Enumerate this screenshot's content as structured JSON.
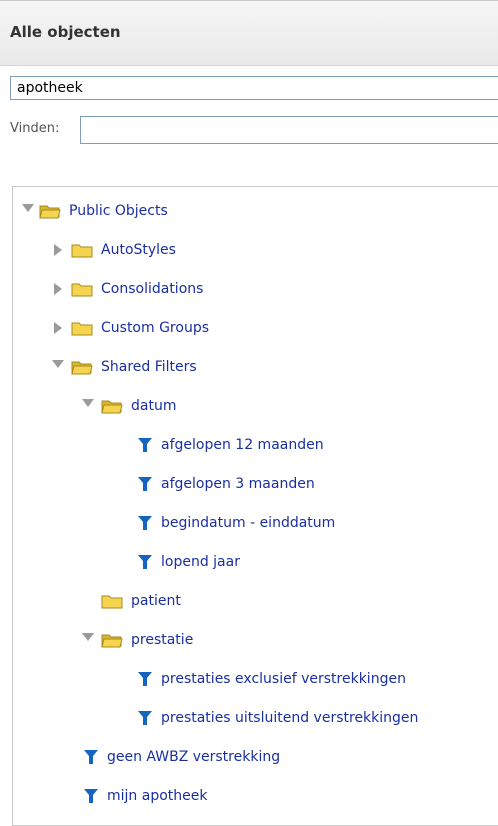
{
  "panel": {
    "title": "Alle objecten",
    "search_value": "apotheek",
    "find_label": "Vinden:",
    "find_value": ""
  },
  "tree": {
    "public_objects": "Public Objects",
    "autostyles": "AutoStyles",
    "consolidations": "Consolidations",
    "custom_groups": "Custom Groups",
    "shared_filters": "Shared Filters",
    "datum": "datum",
    "afgelopen_12": "afgelopen 12 maanden",
    "afgelopen_3": "afgelopen 3 maanden",
    "begindatum": "begindatum - einddatum",
    "lopend_jaar": "lopend jaar",
    "patient": "patient",
    "prestatie": "prestatie",
    "prestaties_excl": "prestaties exclusief verstrekkingen",
    "prestaties_uitsl": "prestaties uitsluitend verstrekkingen",
    "geen_awbz": "geen AWBZ verstrekking",
    "mijn_apotheek": "mijn apotheek"
  },
  "colors": {
    "link": "#1a2fa0",
    "filter_icon": "#1565c0",
    "folder": "#f5d44f"
  }
}
